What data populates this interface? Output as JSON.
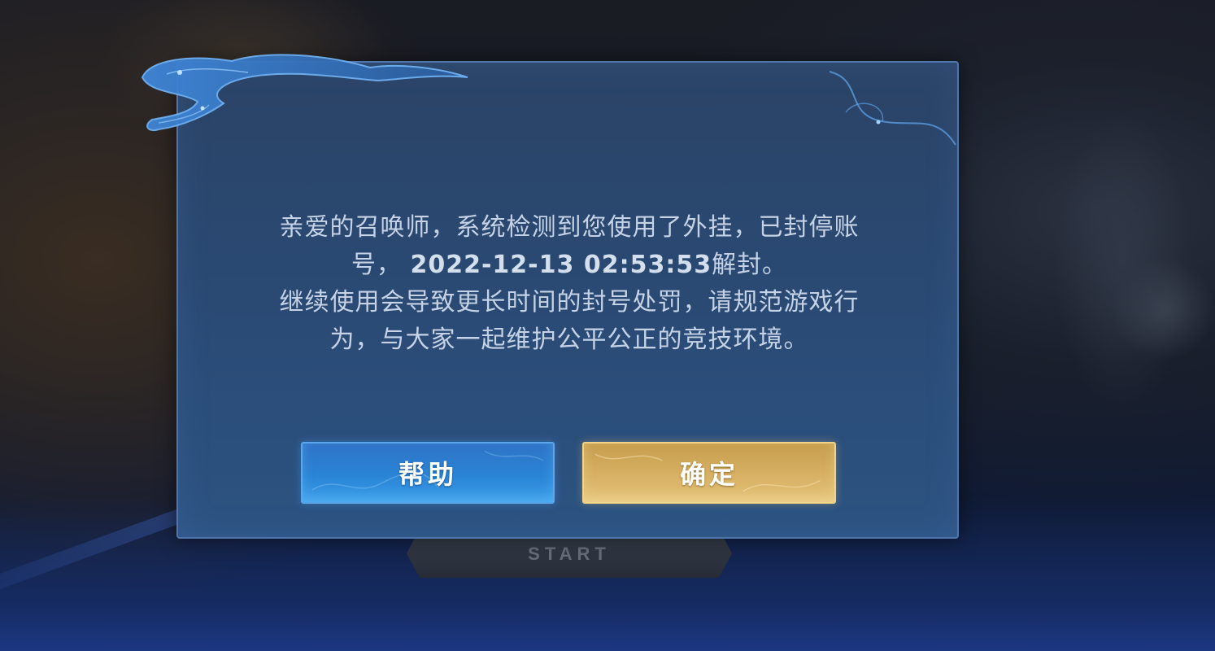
{
  "background": {
    "start_plate_text": "START"
  },
  "dialog": {
    "message_lines": [
      "亲爱的召唤师，系统检测到您使用了外挂，已封停账",
      "号，",
      "2022-12-13 02:53:53",
      "解封。",
      "继续使用会导致更长时间的封号处罚，请规范游戏行",
      "为，与大家一起维护公平公正的竞技环境。"
    ],
    "help_button_label": "帮助",
    "confirm_button_label": "确定"
  },
  "colors": {
    "dialog_bg": "#2a4a74",
    "dialog_border": "#4f77ad",
    "help_button": "#2a84d6",
    "confirm_button": "#d6af62",
    "message_text": "#c6d3e6"
  },
  "icons": [
    "cloud-ornament-icon",
    "swirl-ornament-icon"
  ]
}
